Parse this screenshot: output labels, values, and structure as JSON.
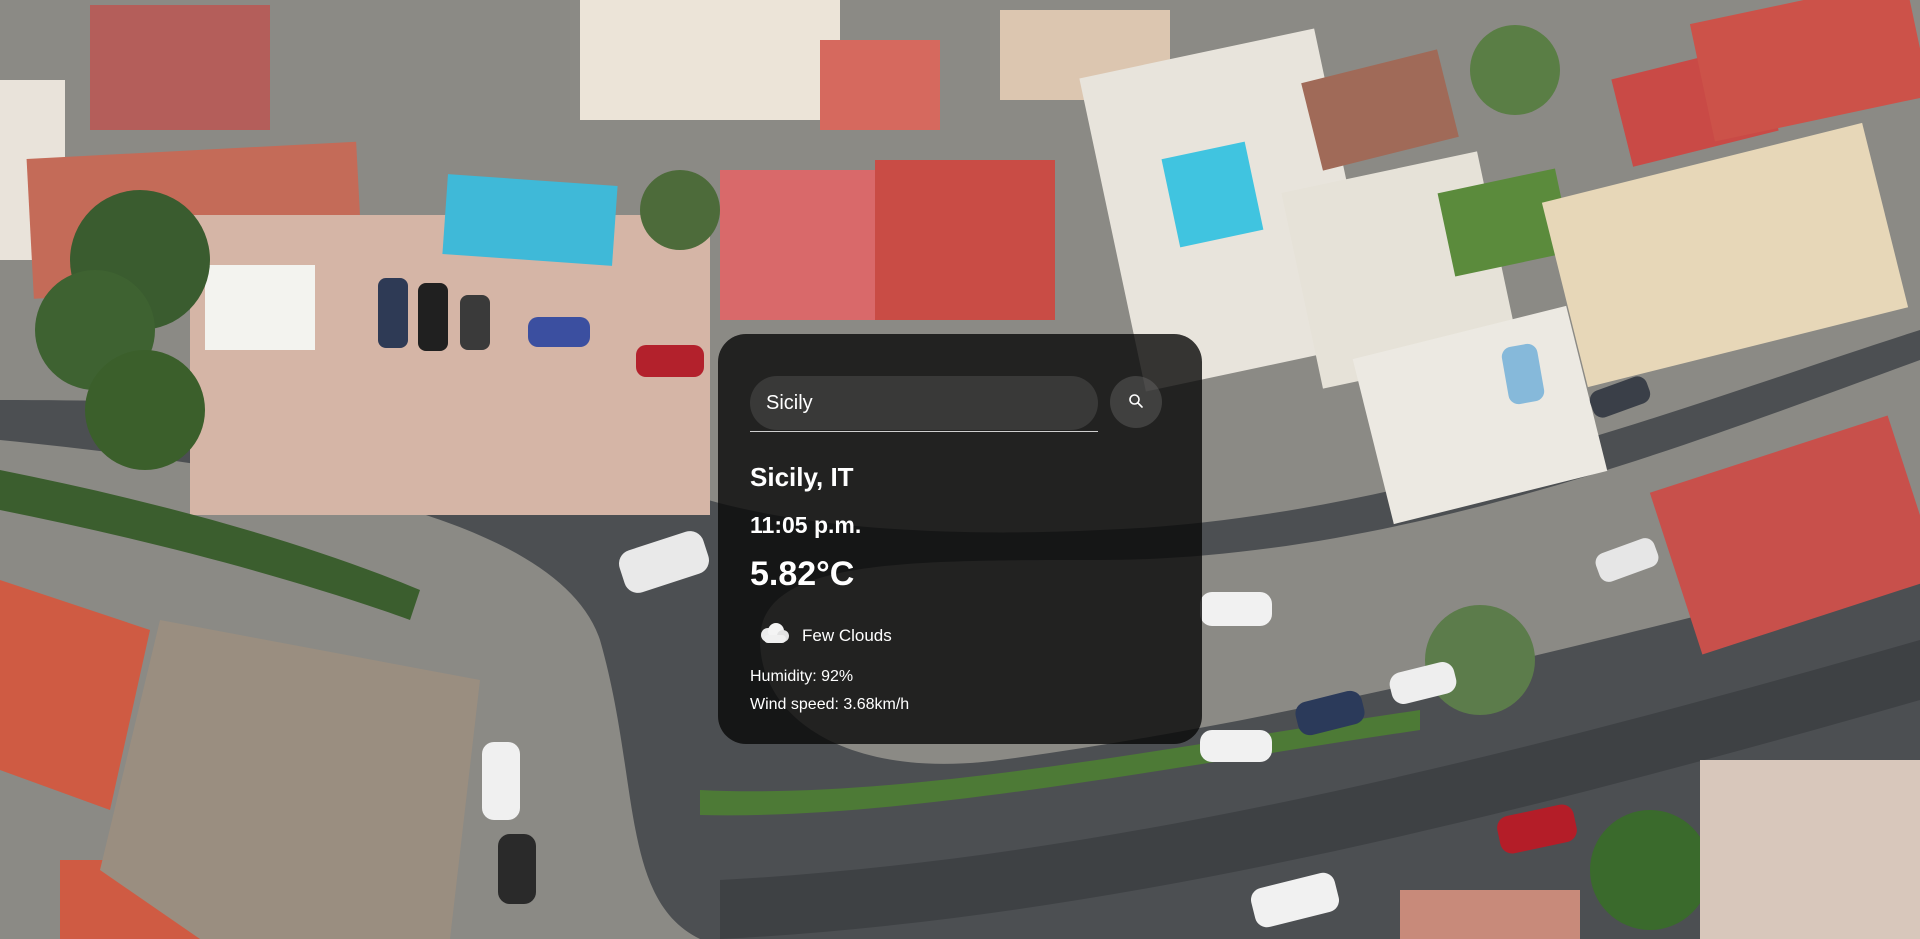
{
  "search": {
    "value": "Sicily",
    "button_icon": "search-icon"
  },
  "weather": {
    "location": "Sicily, IT",
    "time": "11:05 p.m.",
    "temperature": "5.82°C",
    "description": "Few Clouds",
    "description_icon": "cloud-icon",
    "humidity": "Humidity: 92%",
    "wind_speed": "Wind speed: 3.68km/h"
  },
  "colors": {
    "card_background": "#080808",
    "text": "#ffffff",
    "roof_terracotta": "#c8584a",
    "pool_blue": "#3fb9d8"
  }
}
